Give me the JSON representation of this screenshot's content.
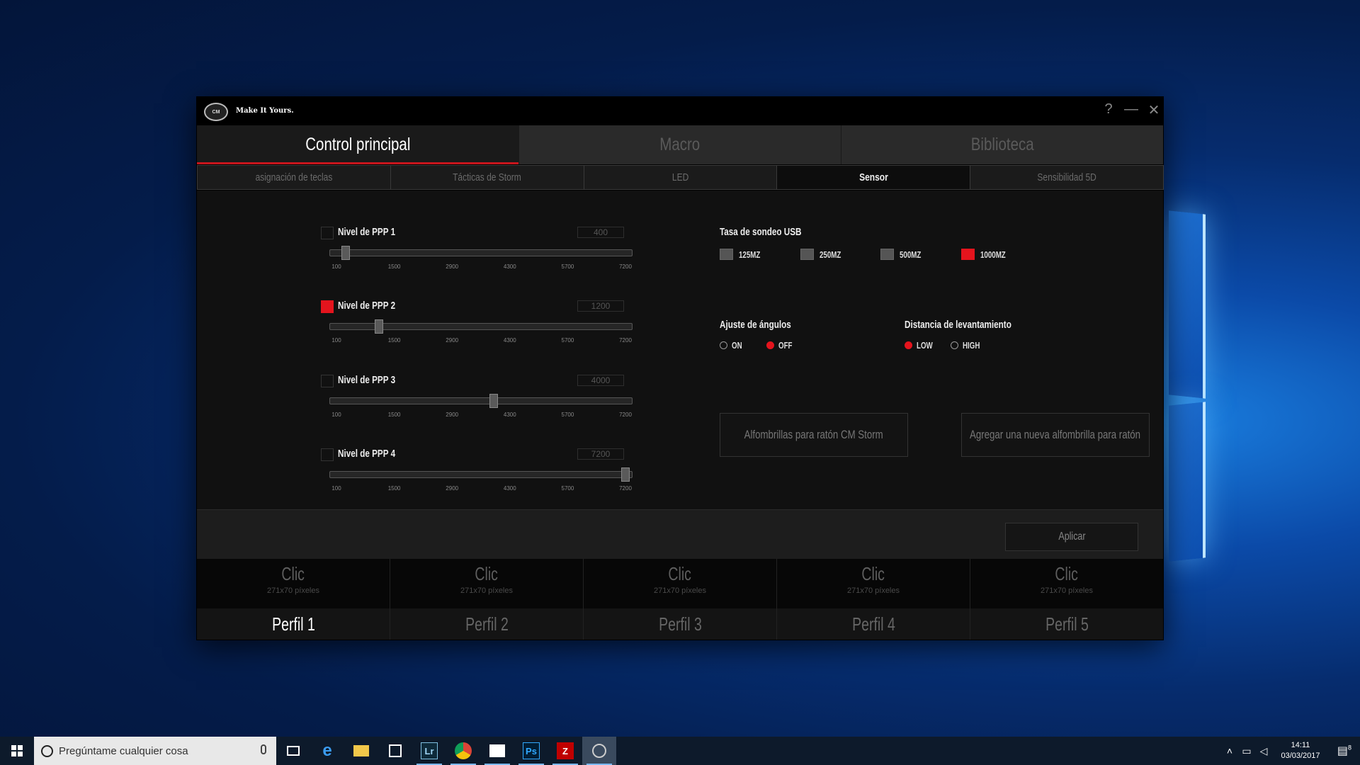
{
  "app": {
    "logo_text": "COOLER MASTER",
    "slogan": "Make It Yours.",
    "controls": {
      "help": "?",
      "minimize": "—",
      "close": "✕"
    }
  },
  "main_tabs": [
    {
      "label": "Control principal",
      "active": true
    },
    {
      "label": "Macro",
      "active": false
    },
    {
      "label": "Biblioteca",
      "active": false
    }
  ],
  "sub_tabs": [
    {
      "label": "asignación de teclas",
      "active": false
    },
    {
      "label": "Tácticas de Storm",
      "active": false
    },
    {
      "label": "LED",
      "active": false
    },
    {
      "label": "Sensor",
      "active": true
    },
    {
      "label": "Sensibilidad 5D",
      "active": false
    }
  ],
  "dpi_levels": [
    {
      "label": "Nivel de PPP 1",
      "value": "400",
      "checked": false,
      "fraction": 0.042
    },
    {
      "label": "Nivel de PPP 2",
      "value": "1200",
      "checked": true,
      "fraction": 0.155
    },
    {
      "label": "Nivel de PPP 3",
      "value": "4000",
      "checked": false,
      "fraction": 0.549
    },
    {
      "label": "Nivel de PPP 4",
      "value": "7200",
      "checked": false,
      "fraction": 1.0
    }
  ],
  "dpi_ticks": [
    "100",
    "1500",
    "2900",
    "4300",
    "5700",
    "7200"
  ],
  "usb_polling": {
    "label": "Tasa de sondeo USB",
    "options": [
      {
        "label": "125MZ",
        "selected": false
      },
      {
        "label": "250MZ",
        "selected": false
      },
      {
        "label": "500MZ",
        "selected": false
      },
      {
        "label": "1000MZ",
        "selected": true
      }
    ]
  },
  "angle_snapping": {
    "label": "Ajuste de ángulos",
    "options": [
      {
        "label": "ON",
        "selected": false
      },
      {
        "label": "OFF",
        "selected": true
      }
    ]
  },
  "lift_distance": {
    "label": "Distancia de levantamiento",
    "options": [
      {
        "label": "LOW",
        "selected": true
      },
      {
        "label": "HIGH",
        "selected": false
      }
    ]
  },
  "buttons": {
    "mousepads": "Alfombrillas para ratón CM Storm",
    "add_mousepad": "Agregar una nueva alfombrilla para ratón",
    "apply": "Aplicar"
  },
  "profiles": [
    {
      "clic": "Clic",
      "size": "271x70 píxeles",
      "name": "Perfil 1",
      "active": true
    },
    {
      "clic": "Clic",
      "size": "271x70 píxeles",
      "name": "Perfil 2",
      "active": false
    },
    {
      "clic": "Clic",
      "size": "271x70 píxeles",
      "name": "Perfil 3",
      "active": false
    },
    {
      "clic": "Clic",
      "size": "271x70 píxeles",
      "name": "Perfil 4",
      "active": false
    },
    {
      "clic": "Clic",
      "size": "271x70 píxeles",
      "name": "Perfil 5",
      "active": false
    }
  ],
  "taskbar": {
    "search_placeholder": "Pregúntame cualquier cosa",
    "apps": [
      "task-view",
      "edge",
      "file-explorer",
      "store",
      "lightroom",
      "chrome",
      "photos",
      "photoshop",
      "filezilla",
      "cooler-master"
    ],
    "lr": "Lr",
    "ps": "Ps",
    "time": "14:11",
    "date": "03/03/2017",
    "notif_count": "8"
  },
  "colors": {
    "accent": "#e4141d",
    "window_bg": "#141414"
  }
}
